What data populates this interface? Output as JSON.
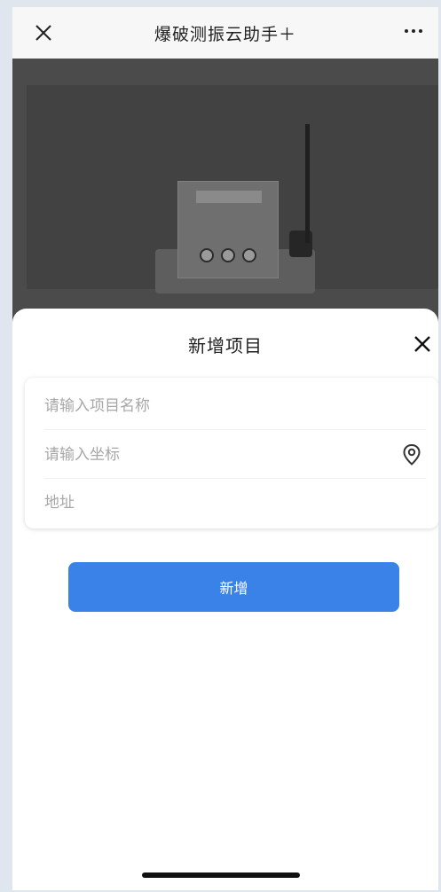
{
  "navbar": {
    "title": "爆破测振云助手＋",
    "close_icon": "close-icon",
    "more_icon": "more-icon"
  },
  "photo": {
    "subject": "device-photo"
  },
  "sheet": {
    "title": "新增项目",
    "close_icon": "close-icon",
    "fields": {
      "project_name": {
        "value": "",
        "placeholder": "请输入项目名称"
      },
      "coordinates": {
        "value": "",
        "placeholder": "请输入坐标",
        "icon": "location-pin-icon"
      },
      "address": {
        "value": "",
        "placeholder": "地址"
      }
    },
    "submit_label": "新增"
  },
  "colors": {
    "accent": "#3b82e8",
    "overlay": "#4b4b4b",
    "background": "#dfe6ee"
  }
}
